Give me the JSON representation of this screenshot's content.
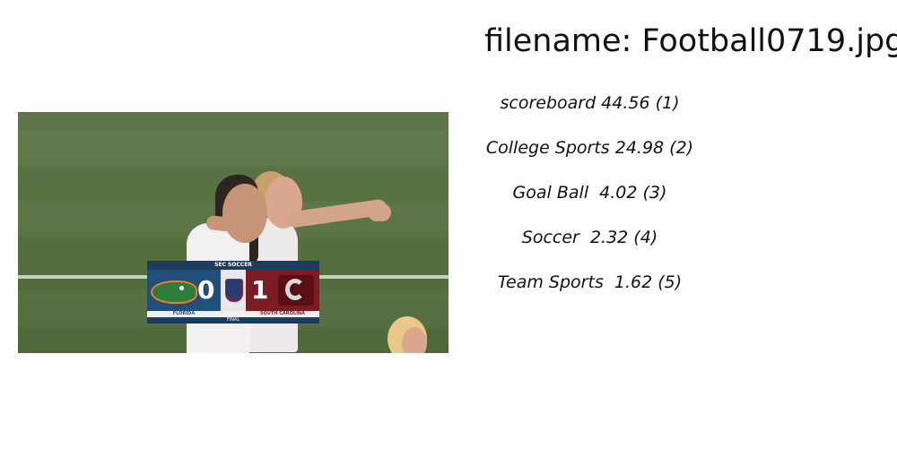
{
  "header": {
    "filename_label": "filename: Football0719.jpg"
  },
  "predictions": [
    {
      "text": "scoreboard 44.56 (1)"
    },
    {
      "text": "College Sports 24.98 (2)"
    },
    {
      "text": "Goal Ball  4.02 (3)"
    },
    {
      "text": "Soccer  2.32 (4)"
    },
    {
      "text": "Team Sports  1.62 (5)"
    }
  ],
  "photo": {
    "scoreboard": {
      "title": "SEC SOCCER",
      "home_team": "FLORIDA",
      "home_score": "0",
      "away_team": "SOUTH CAROLINA",
      "away_score": "1",
      "status": "FINAL"
    }
  }
}
